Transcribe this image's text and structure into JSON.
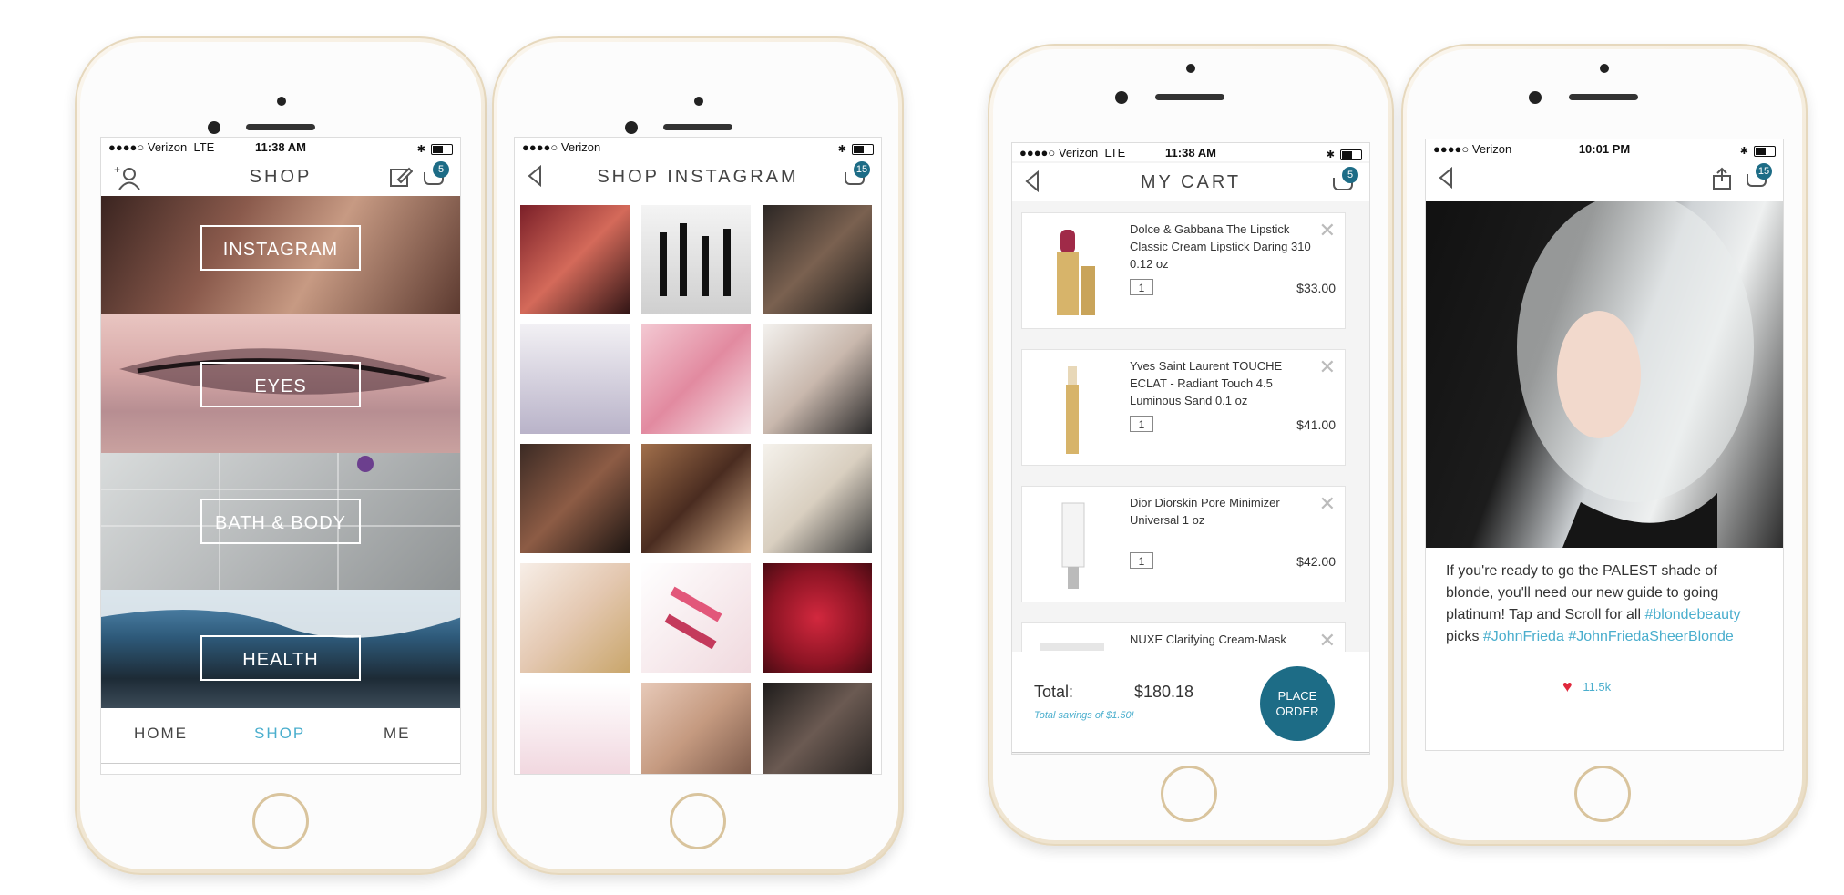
{
  "phones": [
    {
      "status": {
        "carrier": "●●●●○ Verizon",
        "network": "LTE",
        "time": "11:38 AM"
      },
      "nav": {
        "title": "SHOP",
        "cart_count": "5"
      },
      "categories": [
        "INSTAGRAM",
        "EYES",
        "BATH & BODY",
        "HEALTH"
      ],
      "tabs": [
        "HOME",
        "SHOP",
        "ME"
      ]
    },
    {
      "status": {
        "carrier": "●●●●○ Verizon",
        "time": ""
      },
      "nav": {
        "title": "SHOP INSTAGRAM",
        "cart_count": "15"
      }
    },
    {
      "status": {
        "carrier": "●●●●○ Verizon",
        "network": "LTE",
        "time": "11:38 AM"
      },
      "nav": {
        "title": "MY CART",
        "cart_count": "5"
      },
      "items": [
        {
          "name": "Dolce & Gabbana The Lipstick Classic Cream Lipstick  Daring 310 0.12 oz",
          "qty": "1",
          "price": "$33.00"
        },
        {
          "name": "Yves Saint Laurent TOUCHE ECLAT - Radiant Touch 4.5 Luminous Sand 0.1 oz",
          "qty": "1",
          "price": "$41.00"
        },
        {
          "name": "Dior Diorskin Pore Minimizer Universal 1 oz",
          "qty": "1",
          "price": "$42.00"
        },
        {
          "name": "NUXE Clarifying Cream-Mask",
          "qty": "",
          "price": ""
        }
      ],
      "summary": {
        "total_label": "Total:",
        "total_value": "$180.18",
        "savings": "Total savings of $1.50!",
        "order_line1": "PLACE",
        "order_line2": "ORDER"
      }
    },
    {
      "status": {
        "carrier": "●●●●○ Verizon",
        "time": "10:01 PM"
      },
      "nav": {
        "cart_count": "15"
      },
      "post": {
        "text": "If you're ready to go the PALEST shade of blonde, you'll need our new guide to going platinum! Tap and Scroll for all",
        "tag1": "#blondebeauty",
        "mid": "picks",
        "tag2": "#JohnFrieda",
        "tag3": "#JohnFriedaSheerBlonde",
        "likes": "11.5k"
      }
    }
  ],
  "colors": {
    "accent": "#4aaecd",
    "brand": "#1d6c86",
    "heart": "#e0283c"
  }
}
